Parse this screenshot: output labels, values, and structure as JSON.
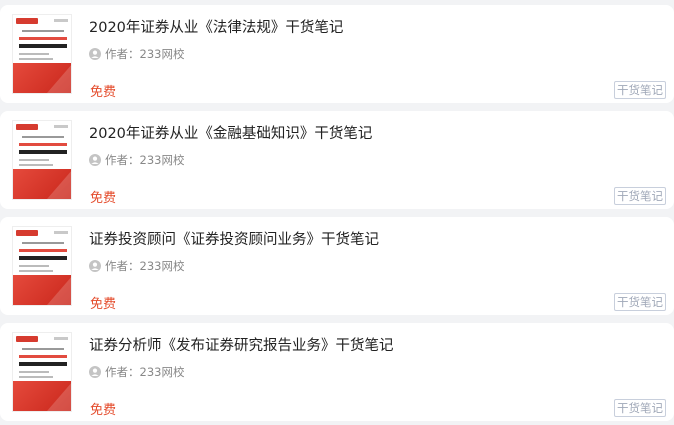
{
  "items": [
    {
      "title": "2020年证券从业《法律法规》干货笔记",
      "author_prefix": "作者：",
      "author": "233网校",
      "price": "免费",
      "tag": "干货笔记",
      "icon": "user-icon"
    },
    {
      "title": "2020年证券从业《金融基础知识》干货笔记",
      "author_prefix": "作者：",
      "author": "233网校",
      "price": "免费",
      "tag": "干货笔记",
      "icon": "user-icon"
    },
    {
      "title": "证券投资顾问《证券投资顾问业务》干货笔记",
      "author_prefix": "作者：",
      "author": "233网校",
      "price": "免费",
      "tag": "干货笔记",
      "icon": "user-icon"
    },
    {
      "title": "证券分析师《发布证券研究报告业务》干货笔记",
      "author_prefix": "作者：",
      "author": "233网校",
      "price": "免费",
      "tag": "干货笔记",
      "icon": "user-icon"
    }
  ],
  "colors": {
    "price": "#e44b2b",
    "tag_border": "#c8cfdc",
    "page_bg": "#f2f3f5"
  }
}
